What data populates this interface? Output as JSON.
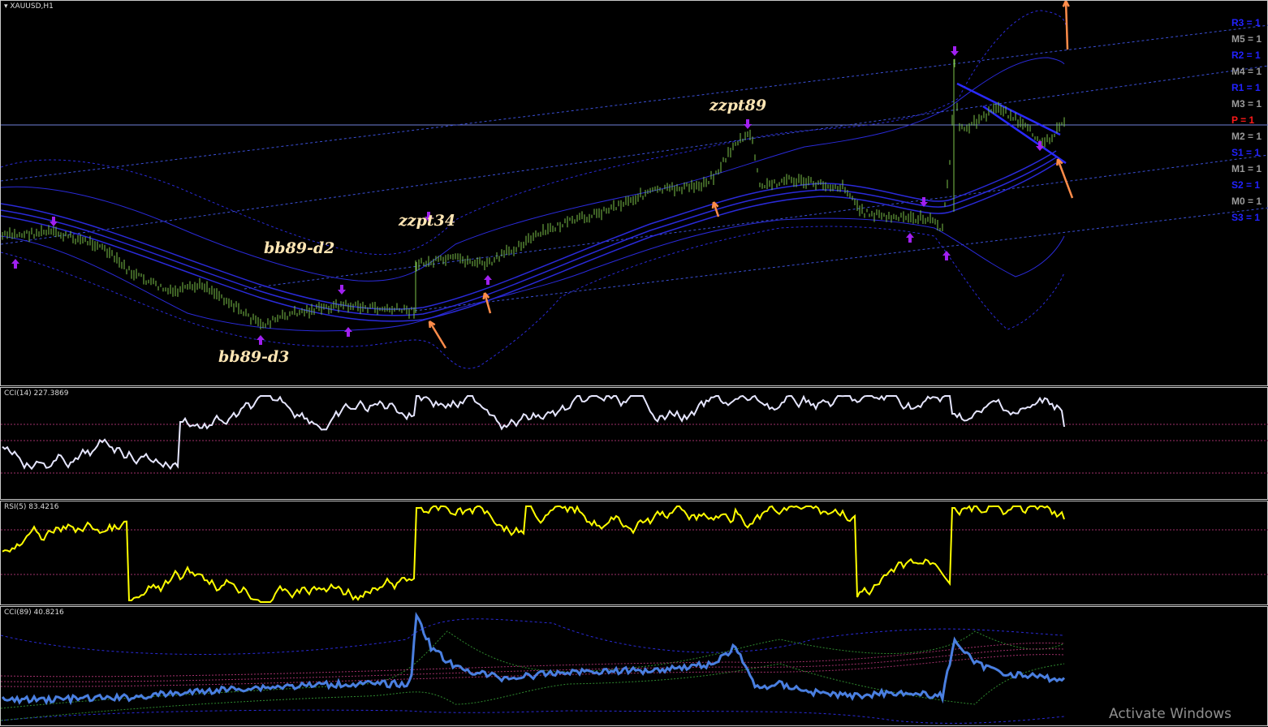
{
  "main_pane": {
    "title": "XAUUSD,H1",
    "annotations": {
      "bb89_d2": "bb89-d2",
      "bb89_d3": "bb89-d3",
      "zzpt34": "zzpt34",
      "zzpt89": "zzpt89"
    },
    "pivot_labels": [
      {
        "key": "r3",
        "text": "R3 = 1",
        "color": "#2222ff"
      },
      {
        "key": "m5",
        "text": "M5 = 1",
        "color": "#9a9a9a"
      },
      {
        "key": "r2",
        "text": "R2 = 1",
        "color": "#2222ff"
      },
      {
        "key": "m4",
        "text": "M4 = 1",
        "color": "#9a9a9a"
      },
      {
        "key": "r1",
        "text": "R1 = 1",
        "color": "#2222ff"
      },
      {
        "key": "m3",
        "text": "M3 = 1",
        "color": "#9a9a9a"
      },
      {
        "key": "p",
        "text": "P = 1",
        "color": "#ff1a1a"
      },
      {
        "key": "m2",
        "text": "M2 = 1",
        "color": "#9a9a9a"
      },
      {
        "key": "s1",
        "text": "S1 = 1",
        "color": "#2222ff"
      },
      {
        "key": "m1",
        "text": "M1 = 1",
        "color": "#9a9a9a"
      },
      {
        "key": "s2",
        "text": "S2 = 1",
        "color": "#2222ff"
      },
      {
        "key": "m0",
        "text": "M0 = 1",
        "color": "#9a9a9a"
      },
      {
        "key": "s3",
        "text": "S3 = 1",
        "color": "#2222ff"
      }
    ]
  },
  "indicators": {
    "cci14": {
      "title": "CCI(14) 227.3869",
      "color": "#e6e6ff"
    },
    "rsi5": {
      "title": "RSI(5) 83.4216",
      "color": "#ffff00"
    },
    "cci89": {
      "title": "CCI(89) 40.8216",
      "color": "#4a7fe0"
    }
  },
  "colors": {
    "background": "#000000",
    "candles": "#7cc24a",
    "bands": "#2a2ad8",
    "arrows": "#ff8c4a",
    "markers": "#a020f0"
  },
  "watermark": "Activate Windows"
}
